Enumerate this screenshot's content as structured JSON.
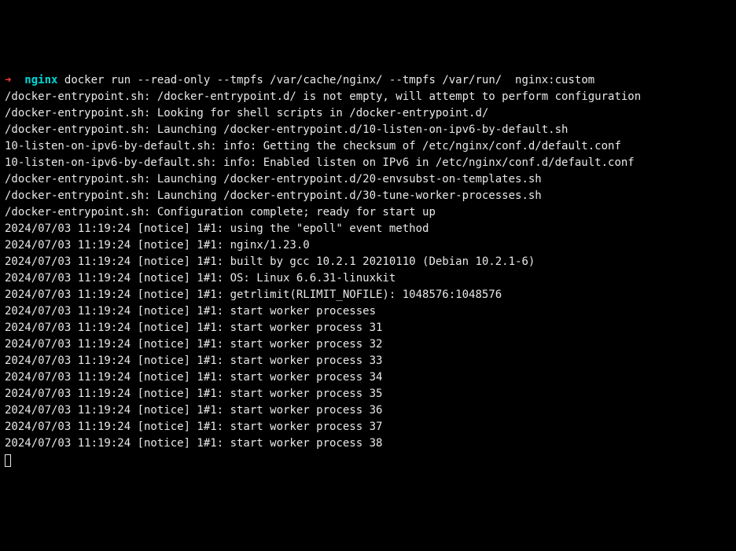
{
  "prompt": {
    "arrow": "➜",
    "dir": "nginx",
    "command": "docker run --read-only --tmpfs /var/cache/nginx/ --tmpfs /var/run/  nginx:custom"
  },
  "lines": [
    "/docker-entrypoint.sh: /docker-entrypoint.d/ is not empty, will attempt to perform configuration",
    "/docker-entrypoint.sh: Looking for shell scripts in /docker-entrypoint.d/",
    "/docker-entrypoint.sh: Launching /docker-entrypoint.d/10-listen-on-ipv6-by-default.sh",
    "10-listen-on-ipv6-by-default.sh: info: Getting the checksum of /etc/nginx/conf.d/default.conf",
    "10-listen-on-ipv6-by-default.sh: info: Enabled listen on IPv6 in /etc/nginx/conf.d/default.conf",
    "/docker-entrypoint.sh: Launching /docker-entrypoint.d/20-envsubst-on-templates.sh",
    "/docker-entrypoint.sh: Launching /docker-entrypoint.d/30-tune-worker-processes.sh",
    "/docker-entrypoint.sh: Configuration complete; ready for start up",
    "2024/07/03 11:19:24 [notice] 1#1: using the \"epoll\" event method",
    "2024/07/03 11:19:24 [notice] 1#1: nginx/1.23.0",
    "2024/07/03 11:19:24 [notice] 1#1: built by gcc 10.2.1 20210110 (Debian 10.2.1-6)",
    "2024/07/03 11:19:24 [notice] 1#1: OS: Linux 6.6.31-linuxkit",
    "2024/07/03 11:19:24 [notice] 1#1: getrlimit(RLIMIT_NOFILE): 1048576:1048576",
    "2024/07/03 11:19:24 [notice] 1#1: start worker processes",
    "2024/07/03 11:19:24 [notice] 1#1: start worker process 31",
    "2024/07/03 11:19:24 [notice] 1#1: start worker process 32",
    "2024/07/03 11:19:24 [notice] 1#1: start worker process 33",
    "2024/07/03 11:19:24 [notice] 1#1: start worker process 34",
    "2024/07/03 11:19:24 [notice] 1#1: start worker process 35",
    "2024/07/03 11:19:24 [notice] 1#1: start worker process 36",
    "2024/07/03 11:19:24 [notice] 1#1: start worker process 37",
    "2024/07/03 11:19:24 [notice] 1#1: start worker process 38"
  ]
}
